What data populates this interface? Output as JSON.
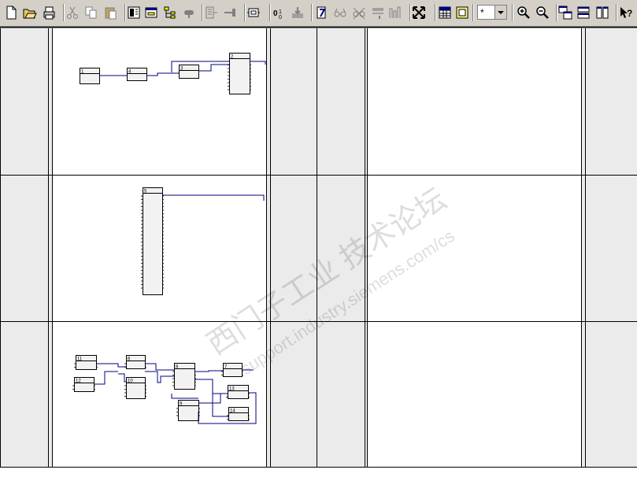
{
  "toolbar": {
    "buttons": [
      {
        "name": "new-file-button",
        "icon": "new-document-icon",
        "enabled": true
      },
      {
        "name": "open-file-button",
        "icon": "open-folder-icon",
        "enabled": true
      },
      {
        "name": "print-button",
        "icon": "printer-icon",
        "enabled": true
      },
      {
        "name": "cut-button",
        "icon": "scissors-icon",
        "enabled": false
      },
      {
        "name": "copy-button",
        "icon": "copy-icon",
        "enabled": false
      },
      {
        "name": "paste-button",
        "icon": "paste-icon",
        "enabled": false
      },
      {
        "name": "catalog-button",
        "icon": "catalog-icon",
        "enabled": true
      },
      {
        "name": "overview-button",
        "icon": "overview-window-icon",
        "enabled": true
      },
      {
        "name": "tree-view-button",
        "icon": "tree-view-icon",
        "enabled": true
      },
      {
        "name": "connect-button",
        "icon": "connector-icon",
        "enabled": false
      },
      {
        "name": "insert-block-button",
        "icon": "insert-block-icon",
        "enabled": false
      },
      {
        "name": "insert-interconnection-button",
        "icon": "interconnection-icon",
        "enabled": false
      },
      {
        "name": "chart-partition-button",
        "icon": "chart-partition-icon",
        "enabled": true
      },
      {
        "name": "compile-button",
        "icon": "compile-icon",
        "enabled": true
      },
      {
        "name": "download-button",
        "icon": "download-icon",
        "enabled": false
      },
      {
        "name": "test-mode-button",
        "icon": "test-mode-icon",
        "enabled": true
      },
      {
        "name": "watch-on-button",
        "icon": "glasses-icon",
        "enabled": false
      },
      {
        "name": "watch-off-button",
        "icon": "glasses-crossed-icon",
        "enabled": false
      },
      {
        "name": "trend-display-button",
        "icon": "trend-icon",
        "enabled": false
      },
      {
        "name": "signal-button",
        "icon": "signal-icon",
        "enabled": false
      },
      {
        "name": "fit-view-button",
        "icon": "expand-arrows-icon",
        "enabled": true
      },
      {
        "name": "table-view-button",
        "icon": "table-icon",
        "enabled": true
      },
      {
        "name": "sheet-view-button",
        "icon": "sheet-icon",
        "enabled": true
      },
      {
        "name": "zoom-in-button",
        "icon": "zoom-in-icon",
        "enabled": true
      },
      {
        "name": "zoom-out-button",
        "icon": "zoom-out-icon",
        "enabled": true
      },
      {
        "name": "cascade-windows-button",
        "icon": "cascade-windows-icon",
        "enabled": true
      },
      {
        "name": "tile-horizontal-button",
        "icon": "tile-horizontal-icon",
        "enabled": true
      },
      {
        "name": "tile-vertical-button",
        "icon": "tile-vertical-icon",
        "enabled": true
      },
      {
        "name": "context-help-button",
        "icon": "help-pointer-icon",
        "enabled": true
      }
    ],
    "zoom_value": "*"
  },
  "rows": [
    {
      "blocks": [
        {
          "label": "1"
        },
        {
          "label": "4"
        },
        {
          "label": "3"
        },
        {
          "label": "2"
        }
      ]
    },
    {
      "blocks": [
        {
          "label": "5"
        }
      ]
    },
    {
      "blocks": [
        {
          "label": "11"
        },
        {
          "label": "12"
        },
        {
          "label": "6"
        },
        {
          "label": "10"
        },
        {
          "label": "8"
        },
        {
          "label": "7"
        },
        {
          "label": "13"
        },
        {
          "label": "14"
        },
        {
          "label": "9"
        }
      ]
    }
  ],
  "colors": {
    "toolbar_bg": "#d4d0c8",
    "margin_column": "#ebebeb",
    "wire": "#000080",
    "block_fill": "#f2f2f2",
    "grid_line": "#000000"
  },
  "watermark": {
    "text_cn": "西门子工业 技术论坛",
    "text_url": "support.industry.siemens.com/cs"
  }
}
